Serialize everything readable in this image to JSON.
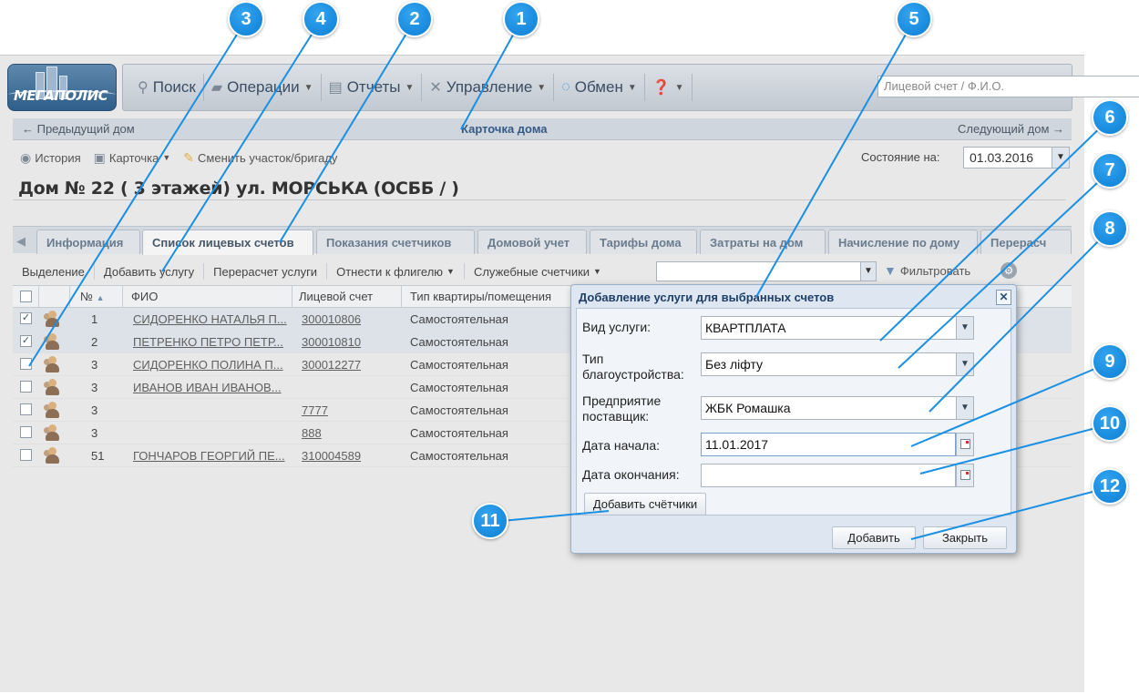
{
  "app": {
    "logo_text": "МЕГАПОЛИС"
  },
  "topbar": {
    "items": [
      {
        "label": "Поиск",
        "icon": "search-icon"
      },
      {
        "label": "Операции",
        "icon": "operations-icon"
      },
      {
        "label": "Отчеты",
        "icon": "reports-icon"
      },
      {
        "label": "Управление",
        "icon": "tools-icon"
      },
      {
        "label": "Обмен",
        "icon": "exchange-icon"
      }
    ],
    "search_placeholder": "Лицевой счет / Ф.И.О."
  },
  "nav": {
    "prev": "← Предыдущий дом",
    "title": "Карточка дома",
    "next": "Следующий дом →"
  },
  "subbar": {
    "history": "История",
    "card": "Карточка",
    "change": "Сменить участок/бригаду",
    "state_label": "Состояние на:",
    "state_date": "01.03.2016"
  },
  "house_title": "Дом № 22 ( 3 этажей) ул. МОРСЬКА (ОСББ / )",
  "tabs": [
    "Информация",
    "Список лицевых счетов",
    "Показания счетчиков",
    "Домовой учет",
    "Тарифы дома",
    "Затраты на дом",
    "Начисление по дому",
    "Перерасч"
  ],
  "grid_toolbar": {
    "selection": "Выделение",
    "add_service": "Добавить услугу",
    "recalc": "Перерасчет услуги",
    "assign": "Отнести к флигелю",
    "service_meters": "Служебные счетчики",
    "filter": "Фильтровать"
  },
  "grid": {
    "headers": {
      "num": "№",
      "fio": "ФИО",
      "account": "Лицевой счет",
      "type": "Тип квартиры/помещения"
    },
    "rows": [
      {
        "checked": true,
        "num": "1",
        "fio": "СИДОРЕНКО НАТАЛЬЯ П...",
        "account": "300010806",
        "type": "Самостоятельная"
      },
      {
        "checked": true,
        "num": "2",
        "fio": "ПЕТРЕНКО ПЕТРО ПЕТР...",
        "account": "300010810",
        "type": "Самостоятельная"
      },
      {
        "checked": false,
        "num": "3",
        "fio": "СИДОРЕНКО ПОЛИНА П...",
        "account": "300012277",
        "type": "Самостоятельная"
      },
      {
        "checked": false,
        "num": "3",
        "fio": "ИВАНОВ ИВАН ИВАНОВ...",
        "account": "",
        "type": "Самостоятельная"
      },
      {
        "checked": false,
        "num": "3",
        "fio": "",
        "account": "7777",
        "type": "Самостоятельная"
      },
      {
        "checked": false,
        "num": "3",
        "fio": "",
        "account": "888",
        "type": "Самостоятельная"
      },
      {
        "checked": false,
        "num": "51",
        "fio": "ГОНЧАРОВ ГЕОРГИЙ ПЕ...",
        "account": "310004589",
        "type": "Самостоятельная"
      }
    ]
  },
  "dialog": {
    "title": "Добавление услуги для выбранных счетов",
    "service_label": "Вид услуги:",
    "service_value": "КВАРТПЛАТА",
    "improvement_label_1": "Тип",
    "improvement_label_2": "благоустройства:",
    "improvement_value": "Без ліфту",
    "supplier_label_1": "Предприятие",
    "supplier_label_2": "поставщик:",
    "supplier_value": "ЖБК Ромашка",
    "start_label": "Дата начала:",
    "start_value": "11.01.2017",
    "end_label": "Дата окончания:",
    "end_value": "",
    "add_meters": "Добавить счётчики",
    "add": "Добавить",
    "close": "Закрыть"
  },
  "callouts": [
    "1",
    "2",
    "3",
    "4",
    "5",
    "6",
    "7",
    "8",
    "9",
    "10",
    "11",
    "12"
  ],
  "colors": {
    "callout": "#1a8fe3",
    "accent": "#355a86"
  }
}
